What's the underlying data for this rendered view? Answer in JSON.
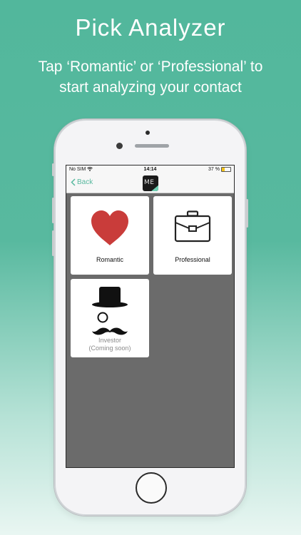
{
  "promo": {
    "headline": "Pick Analyzer",
    "subtitle_line1": "Tap ‘Romantic’ or ‘Professional’ to",
    "subtitle_line2": "start analyzing your contact"
  },
  "status_bar": {
    "carrier": "No SIM",
    "time": "14:14",
    "battery": "37 %",
    "battery_level": 0.37,
    "battery_color": "#f2c21a"
  },
  "nav": {
    "back_label": "Back",
    "logo_text": "ME"
  },
  "analyzers": {
    "romantic": {
      "label": "Romantic",
      "icon": "heart-icon",
      "color": "#c93c3a"
    },
    "professional": {
      "label": "Professional",
      "icon": "briefcase-icon"
    },
    "investor": {
      "label_line1": "Investor",
      "label_line2": "(Coming soon)",
      "icon": "top-hat-monocle-mustache-icon"
    }
  },
  "colors": {
    "accent": "#58b99f",
    "screen_background": "#6b6b6b"
  }
}
